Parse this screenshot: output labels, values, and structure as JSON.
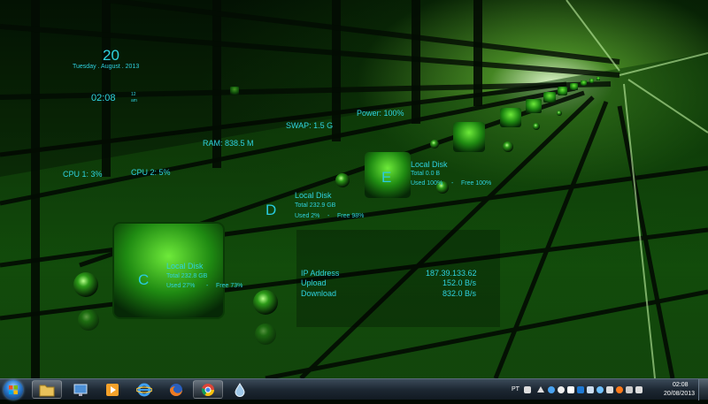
{
  "clock_widget": {
    "day": "20",
    "date": "Tuesday . August . 2013",
    "time": "02:08",
    "hour_format": "12",
    "meridiem": "am"
  },
  "cpu": {
    "cpu1": "CPU 1: 3%",
    "cpu2": "CPU 2: 5%"
  },
  "memory": {
    "ram": "RAM: 838.5 M",
    "swap": "SWAP: 1.5 G",
    "power": "Power: 100%"
  },
  "disks": [
    {
      "letter": "C",
      "title": "Local Disk",
      "total": "Total 232.8 GB",
      "used": "Used 27%",
      "sep": "-",
      "free": "Free 73%"
    },
    {
      "letter": "D",
      "title": "Local Disk",
      "total": "Total 232.9 GB",
      "used": "Used 2%",
      "sep": "-",
      "free": "Free 98%"
    },
    {
      "letter": "E",
      "title": "Local Disk",
      "total": "Total 0.0 B",
      "used": "Used 100%",
      "sep": "-",
      "free": "Free 100%"
    }
  ],
  "network": {
    "ip_label": "IP Address",
    "ip_value": "187.39.133.62",
    "upload_label": "Upload",
    "upload_value": "152.0 B/s",
    "download_label": "Download",
    "download_value": "832.0 B/s"
  },
  "taskbar": {
    "apps": [
      {
        "name": "Windows Explorer",
        "icon": "folder-icon",
        "active": true
      },
      {
        "name": "Control Panel",
        "icon": "monitor-icon",
        "active": false
      },
      {
        "name": "Windows Media Player",
        "icon": "media-player-icon",
        "active": false
      },
      {
        "name": "Internet Explorer",
        "icon": "internet-explorer-icon",
        "active": false
      },
      {
        "name": "Firefox",
        "icon": "firefox-icon",
        "active": false
      },
      {
        "name": "Google Chrome",
        "icon": "chrome-icon",
        "active": true
      },
      {
        "name": "Rainmeter",
        "icon": "drop-icon",
        "active": false
      }
    ],
    "tray": {
      "language": "PT",
      "time": "02:08",
      "date": "20/08/2013"
    }
  },
  "colors": {
    "widget_text": "#2fd2e0",
    "accent_green": "#3bd11e"
  }
}
